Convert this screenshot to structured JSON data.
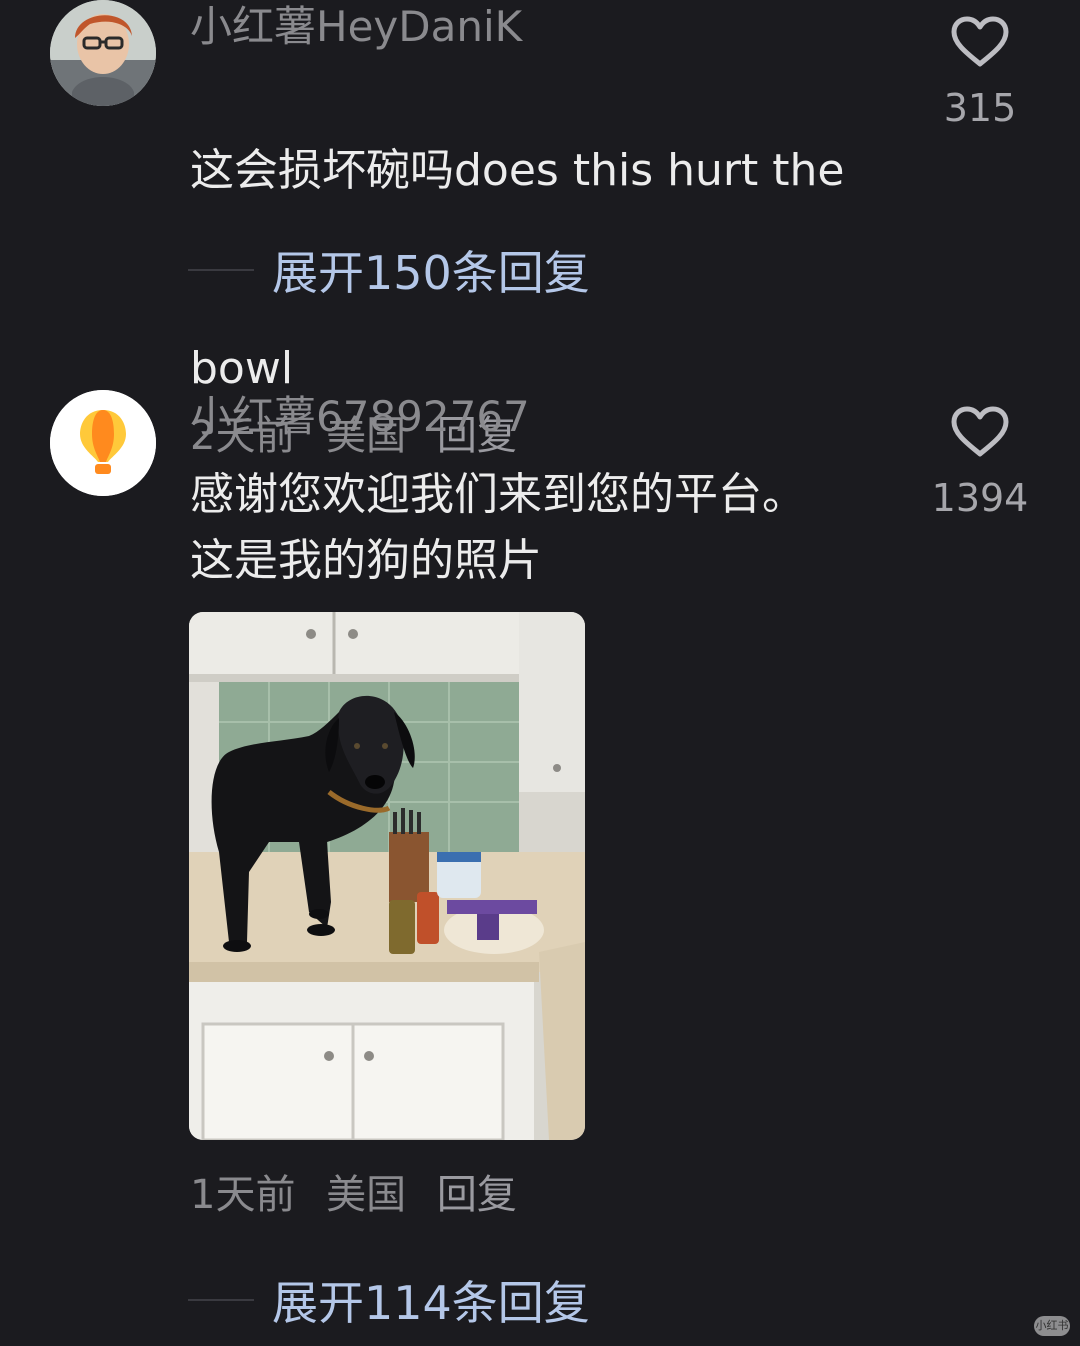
{
  "comments": [
    {
      "username": "小红薯HeyDaniK",
      "content": "这会损坏碗吗does this hurt the",
      "content_cont": "bowl",
      "time": "2天前",
      "location": "美国",
      "reply_label": "回复",
      "likes": "315",
      "expand_label": "展开150条回复",
      "avatar_icon": "user-photo-avatar"
    },
    {
      "username": "小红薯67892767",
      "content": "感谢您欢迎我们来到您的平台。\n这是我的狗的照片",
      "time": "1天前",
      "location": "美国",
      "reply_label": "回复",
      "likes": "1394",
      "expand_label": "展开114条回复",
      "avatar_icon": "hot-air-balloon-avatar"
    }
  ],
  "icons": {
    "like": "heart-outline-icon"
  },
  "colors": {
    "background": "#1b1b1f",
    "username": "#8a8a8e",
    "expand_link": "#b4c7e8"
  },
  "watermark": "小红书"
}
